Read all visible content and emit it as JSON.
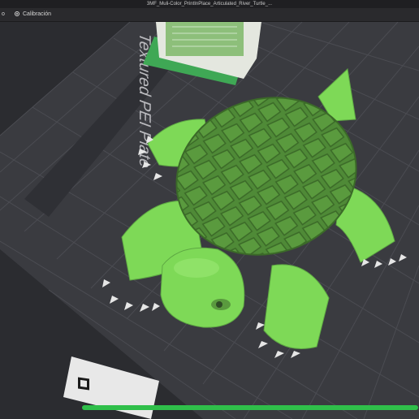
{
  "window": {
    "title": "3MF_Muli-Color_PrintInPlace_Articulated_River_Turtle_..."
  },
  "tabs": [
    {
      "label": "o"
    },
    {
      "label": "Calibración"
    }
  ],
  "build_plate": {
    "label": "Textured PEI Plate"
  },
  "model": {
    "color": "#7ed957",
    "shell_color": "#4f8a37",
    "claw_color": "#e6e6e6"
  },
  "colors": {
    "bed": "#3a3b40",
    "grid": "#4b4c52",
    "accent": "#2fbf4a"
  },
  "progress": {
    "fraction": 1.0
  }
}
